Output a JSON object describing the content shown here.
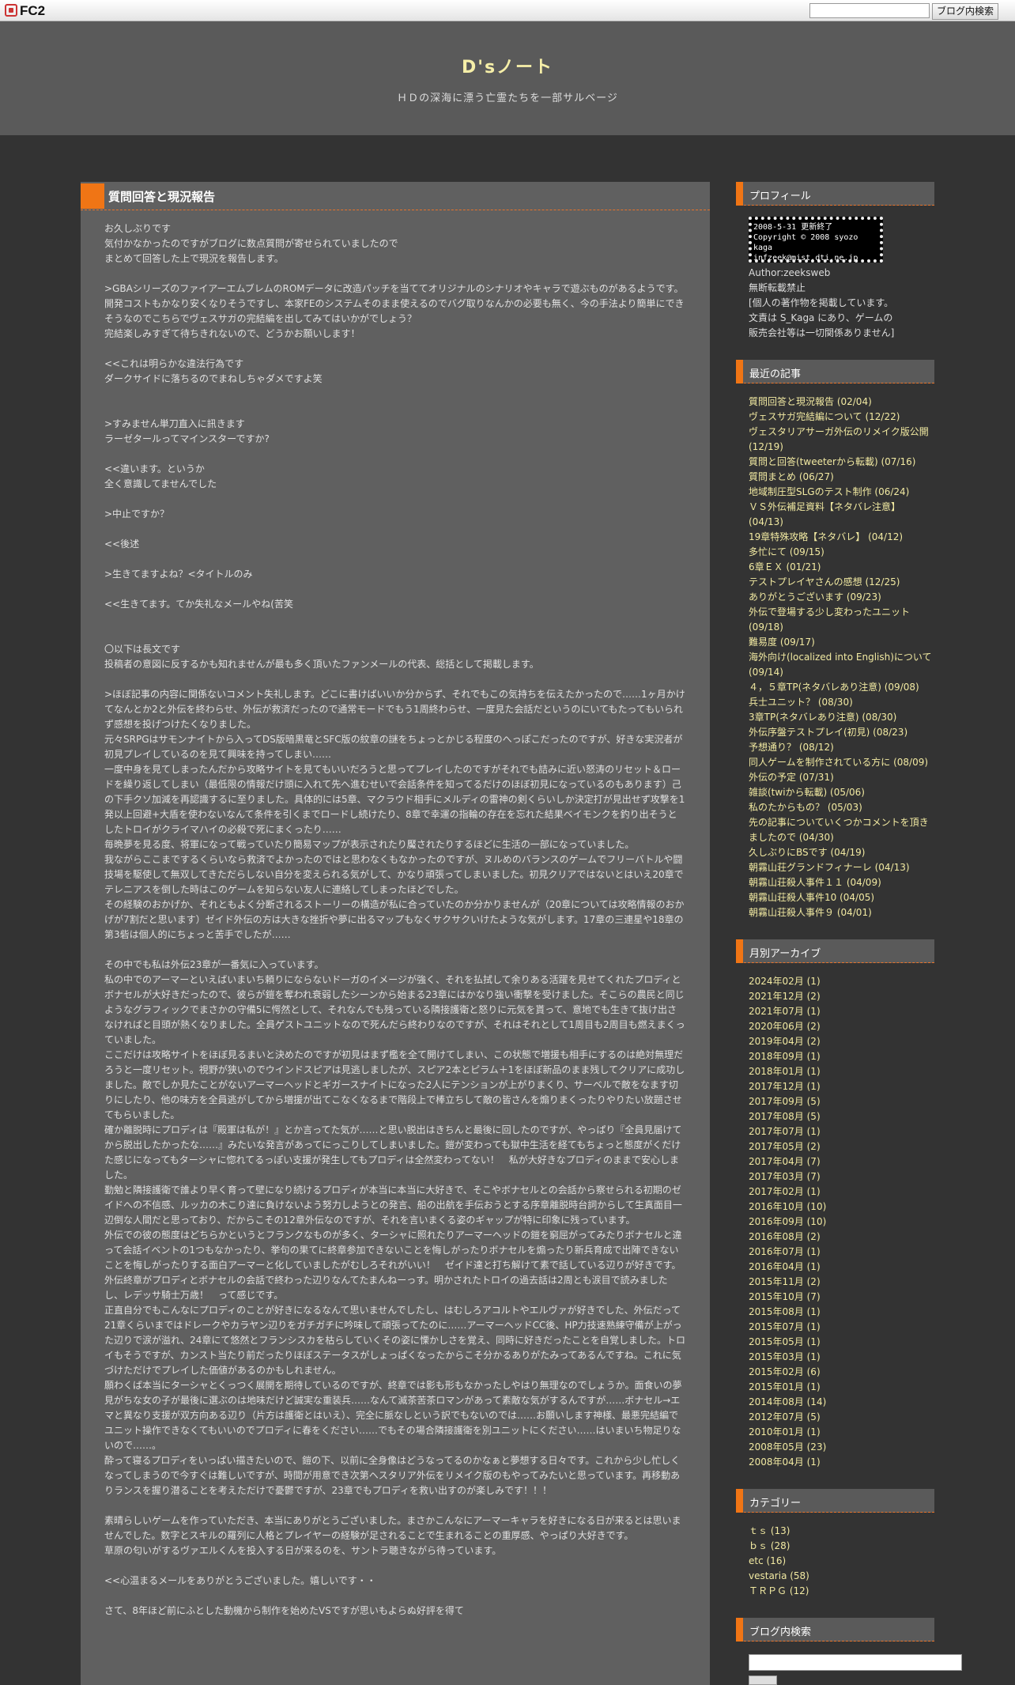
{
  "fc2": {
    "logo": "FC2",
    "search_placeholder": "",
    "search_button": "ブログ内検索"
  },
  "header": {
    "title": "D'sノート",
    "subtitle": "ＨＤの深海に漂う亡霊たちを一部サルベージ"
  },
  "entry": {
    "title": "質問回答と現況報告",
    "lines": [
      "お久しぶりです",
      "気付かなかったのですがブログに数点質問が寄せられていましたので",
      "まとめて回答した上で現況を報告します。",
      "",
      ">GBAシリーズのファイアーエムブレムのROMデータに改造パッチを当ててオリジナルのシナリオやキャラで遊ぶものがあるようです。",
      "開発コストもかなり安くなりそうですし、本家FEのシステムそのまま使えるのでバグ取りなんかの必要も無く、今の手法より簡単にできそうなのでこちらでヴェスサガの完結編を出してみてはいかがでしょう？",
      "完結楽しみすぎて待ちきれないので、どうかお願いします！",
      "",
      "<<これは明らかな違法行為です",
      "ダークサイドに落ちるのでまねしちゃダメですよ笑",
      "",
      "",
      ">すみません単刀直入に訊きます",
      "ラーゼタールってマインスターですか?",
      "",
      "<<違います。というか",
      "全く意識してませんでした",
      "",
      ">中止ですか？",
      "",
      "<<後述",
      "",
      ">生きてますよね？<タイトルのみ",
      "",
      "<<生きてます。てか失礼なメールやね(苦笑",
      "",
      "",
      "〇以下は長文です",
      "投稿者の意図に反するかも知れませんが最も多く頂いたファンメールの代表、総括として掲載します。",
      "",
      ">ほぼ記事の内容に関係ないコメント失礼します。どこに書けばいいか分からず、それでもこの気持ちを伝えたかったので……1ヶ月かけてなんとか2と外伝を終わらせ、外伝が救済だったので通常モードでもう1周終わらせ、一度見た会話だというのにいてもたってもいられず感想を投げつけたくなりました。",
      "元々SRPGはサモンナイトから入ってDS版暗黒竜とSFC版の紋章の謎をちょっとかじる程度のへっぽこだったのですが、好きな実況者が初見プレイしているのを見て興味を持ってしまい……",
      "一度中身を見てしまったんだから攻略サイトを見てもいいだろうと思ってプレイしたのですがそれでも詰みに近い怒涛のリセット＆ロードを繰り返してしまい（最低限の情報だけ頭に入れて先へ進むせいで会話条件を知ってるだけのほぼ初見になっているのもあります）己の下手クソ加減を再認識するに至りました。具体的には5章、マクラウド相手にメルディの雷神の剣くらいしか決定打が見出せず攻撃を1発以上回避+大盾を使わないなんて条件を引くまでロードし続けたり、8章で幸運の指輪の存在を忘れた結果ベイモンクを釣り出そうとしたトロイがクライマハイの必殺で死にまくったり……",
      "毎晩夢を見る度、将軍になって戦っていたり簡易マップが表示されたり魘されたりするほどに生活の一部になっていました。",
      "我ながらここまでするくらいなら救済でよかったのではと思わなくもなかったのですが、ヌルめのバランスのゲームでフリーバトルや闘技場を駆使して無双してきただらしない自分を変えられる気がして、かなり頑張ってしまいました。初見クリアではないとはいえ20章でテレニアスを倒した時はこのゲームを知らない友人に連絡してしまったほどでした。",
      "その経験のおかげか、それともよく分断されるストーリーの構造が私に合っていたのか分かりませんが（20章については攻略情報のおかげが7割だと思います）ゼイド外伝の方は大きな挫折や夢に出るマップもなくサクサクいけたような気がします。17章の三連星や18章の第3砦は個人的にちょっと苦手でしたが……",
      "",
      "その中でも私は外伝23章が一番気に入っています。",
      "私の中でのアーマーといえばいまいち頼りにならないドーガのイメージが強く、それを払拭して余りある活躍を見せてくれたプロディとボナセルが大好きだったので、彼らが鎧を奪われ衰弱したシーンから始まる23章にはかなり強い衝撃を受けました。そこらの農民と同じようなグラフィックでまさかの守備5に愕然として、それなんでも残っている隣接護衛と怒りに元気を貰って、意地でも生きて抜け出さなければと目頭が熱くなりました。全員ゲストユニットなので死んだら終わりなのですが、それはそれとして1周目も2周目も燃えまくっていました。",
      "ここだけは攻略サイトをほぼ見るまいと決めたのですが初見はまず檻を全て開けてしまい、この状態で増援も相手にするのは絶対無理だろうと一度リセット。視野が狭いのでウインドスピアは見逃しましたが、スピア2本とピラム＋1をほぼ新品のまま残してクリアに成功しました。敵でしか見たことがないアーマーヘッドとギガースナイトになった2人にテンションが上がりまくり、サーベルで敵をなます切りにしたり、他の味方を全員逃がしてから増援が出てこなくなるまで階段上で棒立ちして敵の皆さんを煽りまくったりやりたい放題させてもらいました。",
      "確か離脱時にプロディは『殿軍は私が！』とか言ってた気が……と思い脱出はきちんと最後に回したのですが、やっぱり『全員見届けてから脱出したかったな……』みたいな発言があってにっこりしてしまいました。鎧が変わっても獄中生活を経てもちょっと態度がくだけた感じになってもターシャに惚れてるっぽい支援が発生してもプロディは全然変わってない！　私が大好きなプロディのままで安心しました。",
      "勤勉と隣接護衛で誰より早く育って壁になり続けるプロディが本当に本当に大好きで、そこやボナセルとの会話から察せられる初期のゼイドへの不信感、ルッカの木こり達に負けないよう努力しようとの発言、船の出航を手伝おうとする序章離脱時台詞からして生真面目一辺倒な人間だと思っており、だからこその12章外伝なのですが、それを言いまくる姿のギャップが特に印象に残っています。",
      "外伝での彼の態度はどちらかというとフランクなものが多く、ターシャに照れたりアーマーヘッドの鎧を窮屈がってみたりボナセルと違って会話イベントの1つもなかったり、挙句の果てに終章参加できないことを悔しがったりボナセルを煽ったり新兵育成で出陣できないことを悔しがったりする面白アーマーと化していましたがむしろそれがいい！　ゼイド達と打ち解けて素で話している辺りが好きです。外伝終章がプロディとボナセルの会話で終わった辺りなんてたまんねーっす。明かされたトロイの過去話は2周とも涙目で読みましたし、レデッサ騎士万歳！　って感じです。",
      "正直自分でもこんなにプロディのことが好きになるなんて思いませんでしたし、はむしろアコルトやエルヴァが好きでした、外伝だって21章くらいまではドレークやカラヤン辺りをガチガチに吟味して頑張ってたのに……アーマーヘッドCC後、HP力技速熟練守備が上がった辺りで涙が溢れ、24章にて悠然とフランシスカを枯らしていくその姿に慄かしさを覚え、同時に好きだったことを自覚しました。トロイもそうですが、カンスト当たり前だったりほぼステータスがしょっぱくなったからこそ分かるありがたみってあるんですね。これに気づけただけでプレイした価値があるのかもしれません。",
      "願わくば本当にターシャとくっつく展開を期待しているのですが、終章では影も形もなかったしやはり無理なのでしょうか。面食いの夢見がちな女の子が最後に選ぶのは地味だけど誠実な重装兵……なんて滅茶苦茶ロマンがあって素敵な気がするんですが……ボナセル→エマと異なり支援が双方向ある辺り（片方は護衛とはいえ）、完全に脈なしという訳でもないのでは……お願いします神様、最悪完結編でユニット操作できなくてもいいのでプロディに春をください……でもその場合隣接護衛を別ユニットにください……はいまいち物足りないので……。",
      "酔って寝るプロディをいっぱい描きたいので、鎧の下、以前に全身像はどうなってるのかなぁと夢想する日々です。これから少し忙しくなってしまうので今すぐは難しいですが、時間が用意でき次第ヘスタリア外伝をリメイク版のもやってみたいと思っています。再移動ありランスを握り潜ることを考えただけで憂鬱ですが、23章でもプロディを救い出すのが楽しみです！！！",
      "",
      "素晴らしいゲームを作っていただき、本当にありがとうございました。まさかこんなにアーマーキャラを好きになる日が来るとは思いませんでした。数字とスキルの羅列に人格とプレイヤーの経験が足されることで生まれることの重厚感、やっぱり大好きです。",
      "草原の匂いがするヴァエルくんを投入する日が来るのを、サントラ聴きながら待っています。",
      "",
      "<<心温まるメールをありがとうございました。嬉しいです・・",
      "",
      "さて、8年ほど前にふとした動機から制作を始めたVSですが思いもよらぬ好評を得て"
    ]
  },
  "sidebar": {
    "profile": {
      "title": "プロフィール",
      "badge_lines": [
        "2008-5-31 更新終了",
        "Copyright © 2008 syozo kaga",
        "infzeek@mist.dti.ne.jp"
      ],
      "author": "Author:zeeksweb",
      "lines": [
        "無断転載禁止",
        "[個人の著作物を掲載しています。",
        "文責は S_Kaga にあり、ゲームの",
        "販売会社等は一切関係ありません]"
      ]
    },
    "recent": {
      "title": "最近の記事",
      "items": [
        "質問回答と現況報告 (02/04)",
        "ヴェスサガ完結編について (12/22)",
        "ヴェスタリアサーガ外伝のリメイク版公開 (12/19)",
        "質問と回答(tweeterから転載) (07/16)",
        "質問まとめ (06/27)",
        "地域制圧型SLGのテスト制作 (06/24)",
        "ＶＳ外伝補足資料【ネタバレ注意】 (04/13)",
        "19章特殊攻略【ネタバレ】 (04/12)",
        "多忙にて (09/15)",
        "6章ＥＸ (01/21)",
        "テストプレイヤさんの感想 (12/25)",
        "ありがとうございます (09/23)",
        "外伝で登場する少し変わったユニット (09/18)",
        "難易度 (09/17)",
        "海外向け(localized into English)について (09/14)",
        "４，５章TP(ネタバレあり注意) (09/08)",
        "兵士ユニット？ (08/30)",
        "3章TP(ネタバレあり注意) (08/30)",
        "外伝序盤テストプレイ(初見) (08/23)",
        "予想通り？ (08/12)",
        "同人ゲームを制作されている方に (08/09)",
        "外伝の予定 (07/31)",
        "雑談(twiから転載) (05/06)",
        "私のたからもの？ (05/03)",
        "先の記事についていくつかコメントを頂きましたので (04/30)",
        "久しぶりにBSです (04/19)",
        "朝霧山荘グランドフィナーレ (04/13)",
        "朝霧山荘殺人事件１１ (04/09)",
        "朝霧山荘殺人事件10 (04/05)",
        "朝霧山荘殺人事件９ (04/01)"
      ]
    },
    "archive": {
      "title": "月別アーカイブ",
      "items": [
        "2024年02月 (1)",
        "2021年12月 (2)",
        "2021年07月 (1)",
        "2020年06月 (2)",
        "2019年04月 (2)",
        "2018年09月 (1)",
        "2018年01月 (1)",
        "2017年12月 (1)",
        "2017年09月 (5)",
        "2017年08月 (5)",
        "2017年07月 (1)",
        "2017年05月 (2)",
        "2017年04月 (7)",
        "2017年03月 (7)",
        "2017年02月 (1)",
        "2016年10月 (10)",
        "2016年09月 (10)",
        "2016年08月 (2)",
        "2016年07月 (1)",
        "2016年04月 (1)",
        "2015年11月 (2)",
        "2015年10月 (7)",
        "2015年08月 (1)",
        "2015年07月 (1)",
        "2015年05月 (1)",
        "2015年03月 (1)",
        "2015年02月 (6)",
        "2015年01月 (1)",
        "2014年08月 (14)",
        "2012年07月 (5)",
        "2010年01月 (1)",
        "2008年05月 (23)",
        "2008年04月 (1)"
      ]
    },
    "category": {
      "title": "カテゴリー",
      "items": [
        "ｔｓ (13)",
        "ｂｓ (28)",
        "etc (16)",
        "vestaria (58)",
        "ＴＲＰＧ (12)"
      ]
    },
    "search": {
      "title": "ブログ内検索",
      "placeholder": ""
    }
  }
}
